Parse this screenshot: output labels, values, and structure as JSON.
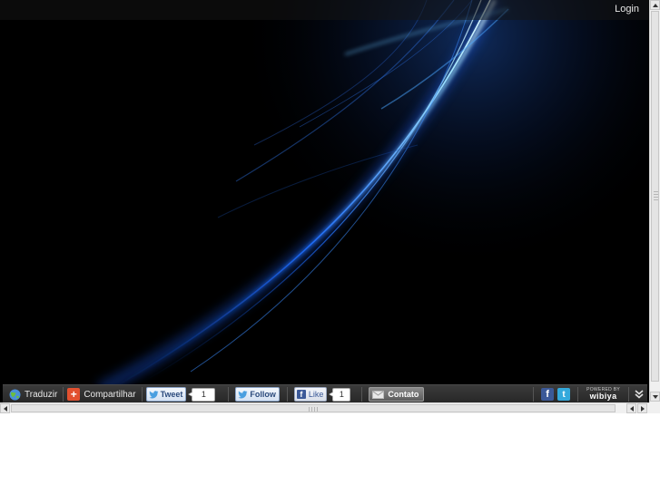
{
  "header": {
    "login_label": "Login"
  },
  "toolbar": {
    "translate_label": "Traduzir",
    "share_label": "Compartilhar",
    "tweet_label": "Tweet",
    "tweet_count": "1",
    "follow_label": "Follow",
    "like_label": "Like",
    "like_count": "1",
    "contact_label": "Contato",
    "powered_by": "POWERED BY",
    "brand": "wibiya"
  },
  "icons": {
    "translate": "globe-icon",
    "share": "plus-share-icon",
    "tweet": "twitter-bird-icon",
    "like": "facebook-icon",
    "contact": "envelope-icon",
    "facebook": "facebook-icon",
    "twitter": "twitter-icon",
    "collapse": "double-chevron-down-icon"
  },
  "colors": {
    "background": "#000000",
    "toolbar": "#2f2f2f",
    "facebook": "#3b5998",
    "twitter": "#33a9dc",
    "streak": "#2a7fff"
  }
}
